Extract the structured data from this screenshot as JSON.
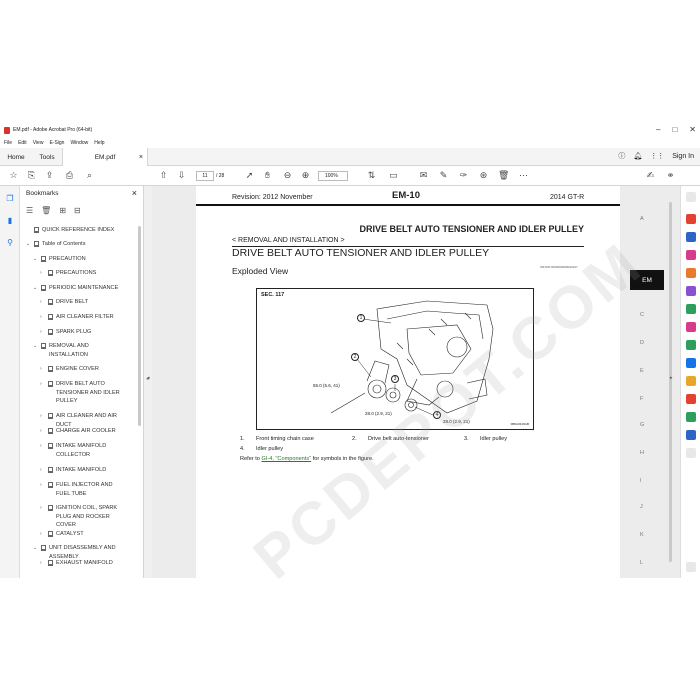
{
  "window": {
    "title": "EM.pdf - Adobe Acrobat Pro (64-bit)",
    "controls": [
      "–",
      "□",
      "✕"
    ]
  },
  "menu": [
    "File",
    "Edit",
    "View",
    "E-Sign",
    "Window",
    "Help"
  ],
  "tabs": {
    "home": "Home",
    "tools": "Tools",
    "doc": "EM.pdf",
    "sign_in": "Sign In"
  },
  "toolbar": {
    "page_current": "11",
    "page_total": "/ 28",
    "zoom": "100%"
  },
  "bookmarks": {
    "title": "Bookmarks",
    "items": [
      {
        "label": "QUICK REFERENCE INDEX",
        "level": 0,
        "chev": ""
      },
      {
        "label": "Table of Contents",
        "level": 0,
        "chev": "v"
      },
      {
        "label": "PRECAUTION",
        "level": 1,
        "chev": "v"
      },
      {
        "label": "PRECAUTIONS",
        "level": 2,
        "chev": ">"
      },
      {
        "label": "PERIODIC MAINTENANCE",
        "level": 1,
        "chev": "v"
      },
      {
        "label": "DRIVE BELT",
        "level": 2,
        "chev": ">"
      },
      {
        "label": "AIR CLEANER FILTER",
        "level": 2,
        "chev": ">"
      },
      {
        "label": "SPARK PLUG",
        "level": 2,
        "chev": ">"
      },
      {
        "label": "REMOVAL AND INSTALLATION",
        "level": 1,
        "chev": "v"
      },
      {
        "label": "ENGINE COVER",
        "level": 2,
        "chev": ">"
      },
      {
        "label": "DRIVE BELT AUTO TENSIONER AND IDLER PULLEY",
        "level": 2,
        "chev": ">"
      },
      {
        "label": "AIR CLEANER AND AIR DUCT",
        "level": 2,
        "chev": ">"
      },
      {
        "label": "CHARGE AIR COOLER",
        "level": 2,
        "chev": ">"
      },
      {
        "label": "INTAKE MANIFOLD COLLECTOR",
        "level": 2,
        "chev": ">"
      },
      {
        "label": "INTAKE MANIFOLD",
        "level": 2,
        "chev": ">"
      },
      {
        "label": "FUEL INJECTOR AND FUEL TUBE",
        "level": 2,
        "chev": ">"
      },
      {
        "label": "IGNITION COIL, SPARK PLUG AND ROCKER COVER",
        "level": 2,
        "chev": ">"
      },
      {
        "label": "CATALYST",
        "level": 2,
        "chev": ">"
      },
      {
        "label": "UNIT DISASSEMBLY AND ASSEMBLY",
        "level": 1,
        "chev": "v"
      },
      {
        "label": "EXHAUST MANIFOLD",
        "level": 2,
        "chev": ">"
      }
    ]
  },
  "page": {
    "revision": "Revision: 2012 November",
    "section_code": "EM-10",
    "model": "2014 GT-R",
    "main_title": "DRIVE BELT AUTO TENSIONER AND IDLER PULLEY",
    "breadcrumb": "< REMOVAL AND INSTALLATION >",
    "section_title": "DRIVE BELT AUTO TENSIONER AND IDLER PULLEY",
    "subtitle": "Exploded View",
    "ref_code": "INFOID:0000000009033017",
    "figure": {
      "sec": "SEC. 117",
      "code": "MBIA0316GB",
      "callouts": [
        "1",
        "2",
        "3",
        "4"
      ],
      "torques": [
        "55.0 (5.6, 41)",
        "28.0 (2.9, 21)",
        "28.0 (2.9, 21)"
      ]
    },
    "legend": [
      {
        "num": "1.",
        "text": "Front timing chain case"
      },
      {
        "num": "2.",
        "text": "Drive belt auto-tensioner"
      },
      {
        "num": "3.",
        "text": "Idler pulley"
      },
      {
        "num": "4.",
        "text": "Idler pulley"
      }
    ],
    "refer_prefix": "Refer to ",
    "refer_link": "GI-4, \"Components\"",
    "refer_suffix": " for symbols in the figure.",
    "side_tab": "EM",
    "side_letters": [
      "A",
      "C",
      "D",
      "E",
      "F",
      "G",
      "H",
      "I",
      "J",
      "K",
      "L"
    ],
    "watermark": "PCDEPOT.COM"
  }
}
